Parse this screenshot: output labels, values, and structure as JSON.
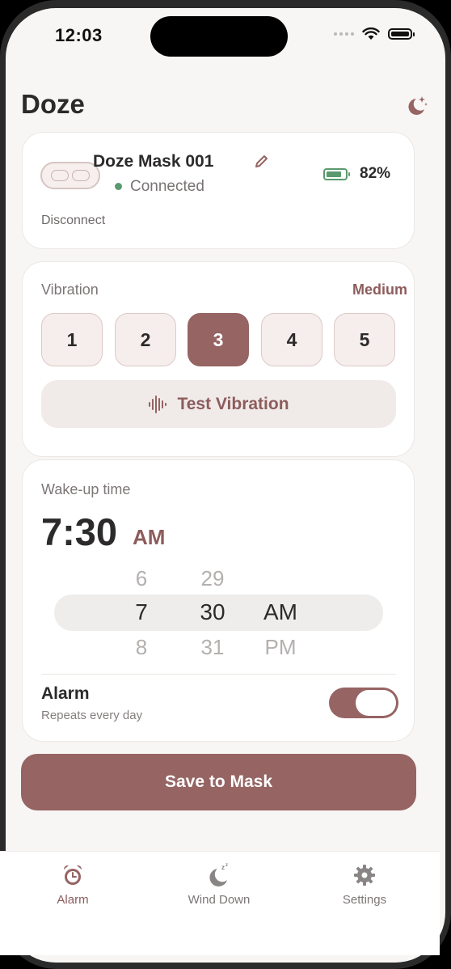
{
  "status_bar": {
    "time": "12:03"
  },
  "header": {
    "title": "Doze",
    "moon_icon": "moon-stars-icon"
  },
  "device": {
    "name": "Doze Mask 001",
    "status": "Connected",
    "battery": "82%",
    "battery_level": 0.82,
    "disconnect_label": "Disconnect",
    "status_color": "#5a9a6e"
  },
  "vibration": {
    "label": "Vibration",
    "value": "Medium",
    "levels": [
      "1",
      "2",
      "3",
      "4",
      "5"
    ],
    "selected": "3",
    "test_label": "Test Vibration"
  },
  "wake": {
    "label": "Wake-up time",
    "time": "7:30",
    "ampm": "AM",
    "picker": {
      "hours": [
        "6",
        "7",
        "8"
      ],
      "minutes": [
        "29",
        "30",
        "31"
      ],
      "periods": [
        "AM",
        "PM"
      ]
    },
    "alarm_title": "Alarm",
    "alarm_sub": "Repeats every day",
    "alarm_on": true
  },
  "save_label": "Save to Mask",
  "tabs": [
    {
      "label": "Alarm",
      "icon": "alarm-clock-icon",
      "active": true
    },
    {
      "label": "Wind Down",
      "icon": "moon-zzz-icon",
      "active": false
    },
    {
      "label": "Settings",
      "icon": "gear-icon",
      "active": false
    }
  ],
  "colors": {
    "accent": "#956463",
    "accent_text": "#8d5c5c",
    "background": "#f8f6f4"
  }
}
